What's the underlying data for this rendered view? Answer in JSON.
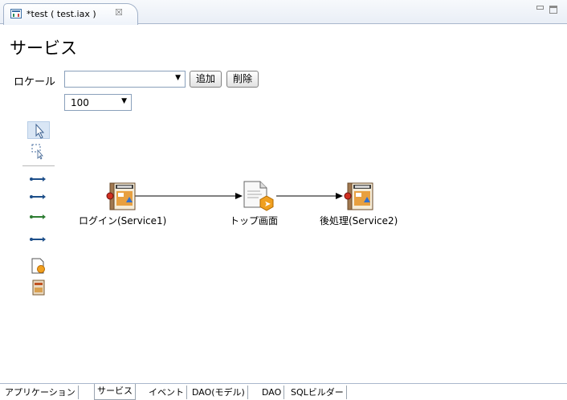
{
  "editor_tab": {
    "title": "*test ( test.iax )",
    "close_glyph": "☒"
  },
  "page": {
    "title": "サービス"
  },
  "toolbar": {
    "locale_label": "ロケール",
    "locale_value": "",
    "add_label": "追加",
    "delete_label": "削除",
    "zoom_value": "100"
  },
  "palette": {
    "tools": [
      "select-arrow-icon",
      "marquee-select-icon",
      "connection-tool-icon",
      "connection-tool-icon",
      "connection-tool-icon",
      "connection-tool-icon",
      "screen-node-icon",
      "service-node-icon"
    ]
  },
  "diagram": {
    "nodes": [
      {
        "label": "ログイン(Service1)"
      },
      {
        "label": "トップ画面"
      },
      {
        "label": "後処理(Service2)"
      }
    ]
  },
  "bottom_tabs": {
    "application": "アプリケーション",
    "service": "サービス",
    "event": "イベント",
    "dao_model": "DAO(モデル)",
    "dao": "DAO",
    "sql_builder": "SQLビルダー"
  },
  "colors": {
    "accent": "#3a6ea5",
    "connector": "#000000",
    "node_orange": "#f0a020"
  }
}
